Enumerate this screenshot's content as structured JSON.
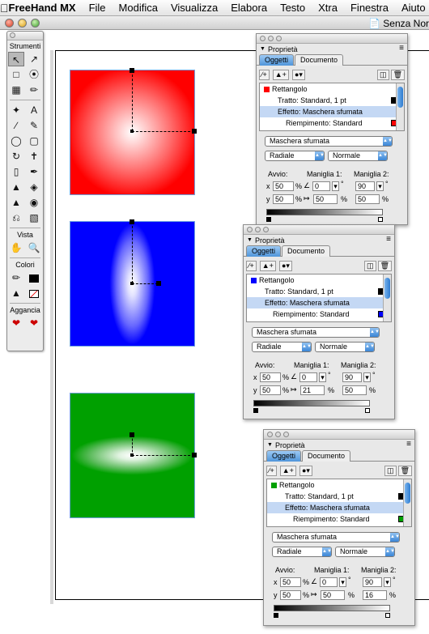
{
  "menubar": {
    "apple": "",
    "app_name": "FreeHand MX",
    "items": [
      "File",
      "Modifica",
      "Visualizza",
      "Elabora",
      "Testo",
      "Xtra",
      "Finestra",
      "Aiuto"
    ]
  },
  "document": {
    "title": "Senza Nor"
  },
  "toolbox": {
    "strumenti_label": "Strumenti",
    "vista_label": "Vista",
    "colori_label": "Colori",
    "aggancia_label": "Aggancia"
  },
  "panels": [
    {
      "title": "Proprietà",
      "tab_objects": "Oggetti",
      "tab_document": "Documento",
      "object_type": "Rettangolo",
      "stroke": "Tratto: Standard, 1 pt",
      "effect": "Effetto: Maschera sfumata",
      "fill": "Riempimento: Standard",
      "fill_color": "#ff0000",
      "effect_select": "Maschera sfumata",
      "gradient_type": "Radiale",
      "blend_mode": "Normale",
      "avvio_label": "Avvio:",
      "maniglia1_label": "Maniglia 1:",
      "maniglia2_label": "Maniglia 2:",
      "x_label": "x",
      "y_label": "y",
      "avvio_x": "50",
      "avvio_y": "50",
      "angle": "0",
      "length": "50",
      "m2_x": "90",
      "m2_y": "50",
      "pct": "%"
    },
    {
      "title": "Proprietà",
      "tab_objects": "Oggetti",
      "tab_document": "Documento",
      "object_type": "Rettangolo",
      "stroke": "Tratto: Standard, 1 pt",
      "effect": "Effetto: Maschera sfumata",
      "fill": "Riempimento: Standard",
      "fill_color": "#0000ff",
      "effect_select": "Maschera sfumata",
      "gradient_type": "Radiale",
      "blend_mode": "Normale",
      "avvio_label": "Avvio:",
      "maniglia1_label": "Maniglia 1:",
      "maniglia2_label": "Maniglia 2:",
      "x_label": "x",
      "y_label": "y",
      "avvio_x": "50",
      "avvio_y": "50",
      "angle": "0",
      "length": "21",
      "m2_x": "90",
      "m2_y": "50",
      "pct": "%"
    },
    {
      "title": "Proprietà",
      "tab_objects": "Oggetti",
      "tab_document": "Documento",
      "object_type": "Rettangolo",
      "stroke": "Tratto: Standard, 1 pt",
      "effect": "Effetto: Maschera sfumata",
      "fill": "Riempimento: Standard",
      "fill_color": "#00a000",
      "effect_select": "Maschera sfumata",
      "gradient_type": "Radiale",
      "blend_mode": "Normale",
      "avvio_label": "Avvio:",
      "maniglia1_label": "Maniglia 1:",
      "maniglia2_label": "Maniglia 2:",
      "x_label": "x",
      "y_label": "y",
      "avvio_x": "50",
      "avvio_y": "50",
      "angle": "0",
      "length": "50",
      "m2_x": "90",
      "m2_y": "16",
      "pct": "%"
    }
  ],
  "colors": {
    "red_fill": "#ff0000",
    "blue_fill": "#0000ff",
    "green_fill": "#00a000",
    "selection_blue": "#c4d8f4"
  }
}
